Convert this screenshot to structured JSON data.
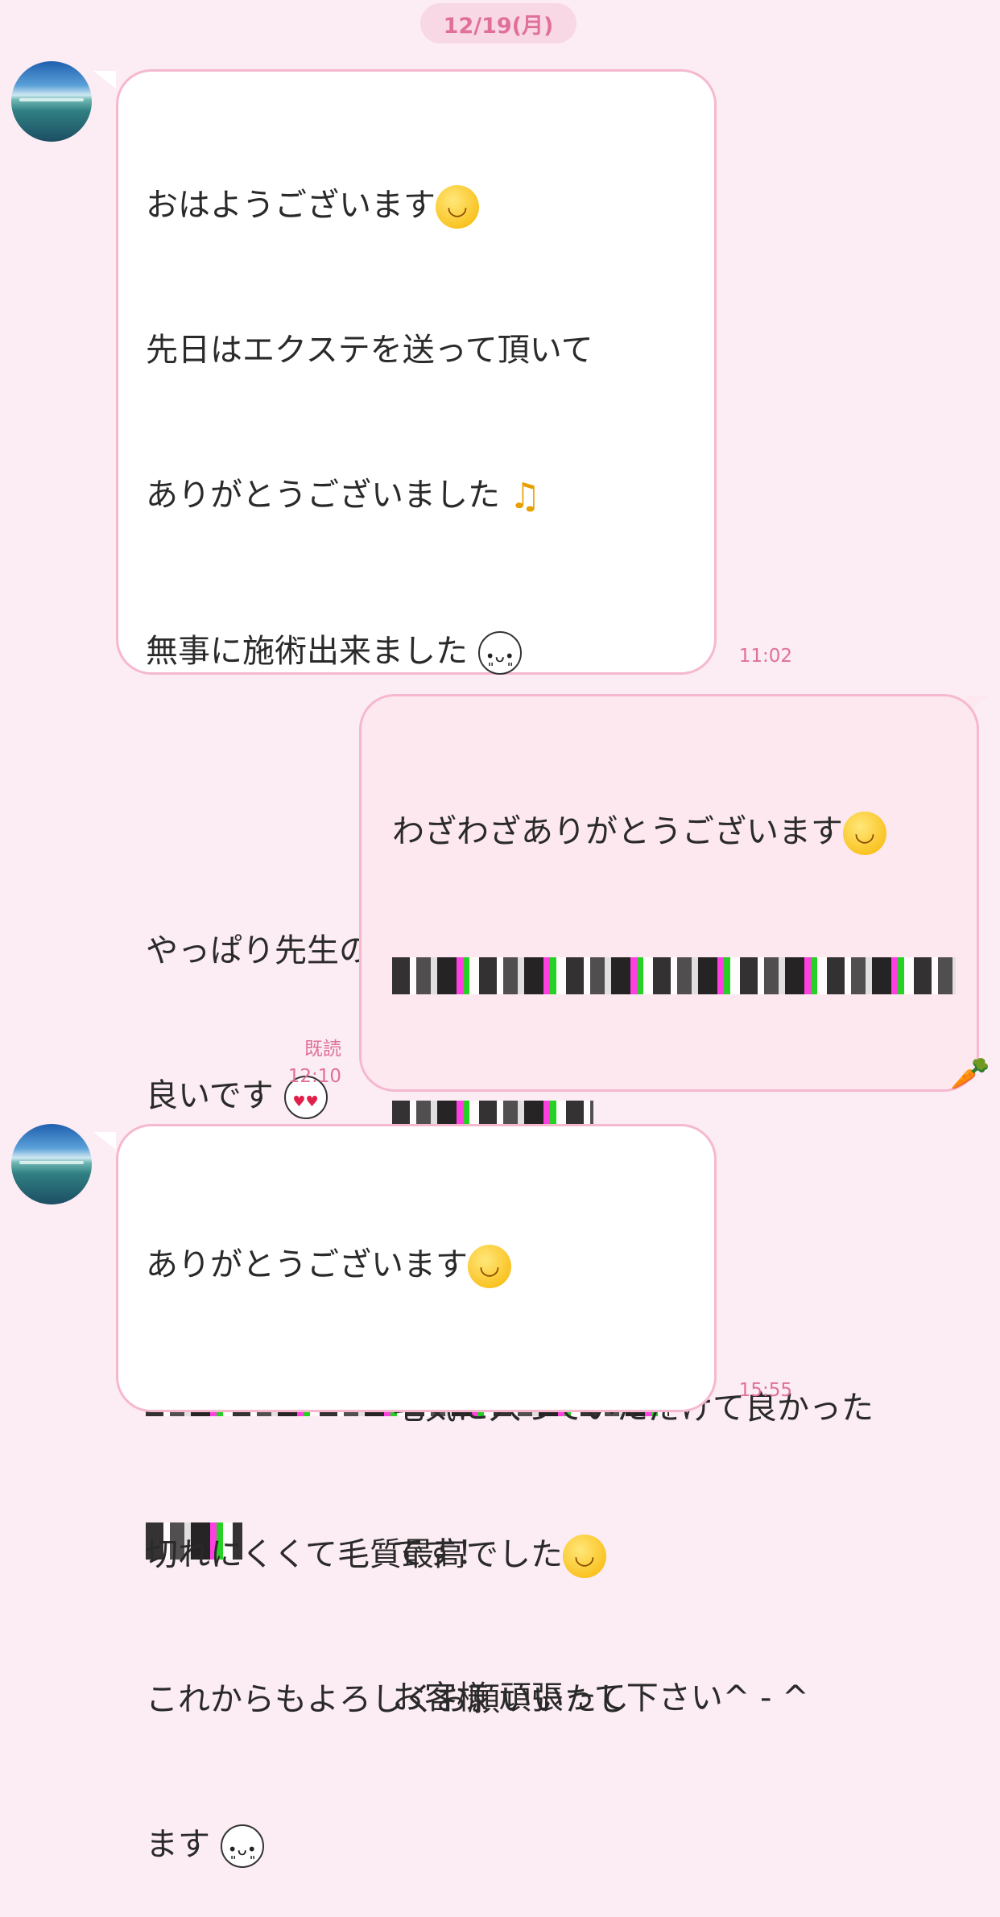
{
  "date": "12/19(月)",
  "messages": [
    {
      "side": "left",
      "lines": [
        "おはようございます",
        "先日はエクステを送って頂いて",
        "ありがとうございました",
        "無事に施術出来ました",
        "",
        "やっぱり先生のエクステすごく",
        "良いです"
      ],
      "time": "11:02"
    },
    {
      "side": "right",
      "lines": [
        "わざわざありがとうございます",
        "",
        "毛気に入っていただけて良かった",
        "です！",
        "お客様 頑張って下さい^ - ^"
      ],
      "read": "既読",
      "time": "12:10"
    },
    {
      "side": "left",
      "lines": [
        "ありがとうございます",
        "",
        "切れにくくて毛質最高でした",
        "これからもよろしくお願いいたし",
        "ます"
      ],
      "time": "15:55"
    }
  ],
  "icons": {
    "avatar": "avatar-icon",
    "smile": "smile-emoji-icon",
    "face": "face-emoji-icon",
    "heart": "heart-eyes-emoji-icon",
    "note": "music-note-icon",
    "carrot": "carrot-icon"
  },
  "colors": {
    "background": "#fcecf3",
    "bubble_border": "#f5b8cf",
    "accent_text": "#e0709a"
  }
}
